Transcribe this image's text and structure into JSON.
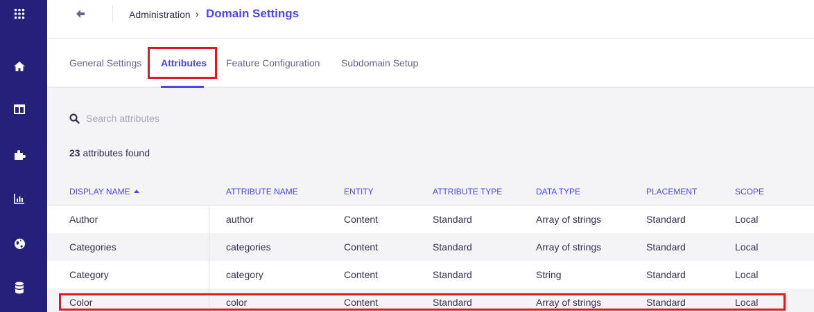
{
  "sidebar": {
    "items": [
      {
        "icon": "grid-menu-icon"
      },
      {
        "icon": "home-icon"
      },
      {
        "icon": "layout-icon"
      },
      {
        "icon": "puzzle-icon"
      },
      {
        "icon": "chart-icon"
      },
      {
        "icon": "globe-icon"
      },
      {
        "icon": "database-icon"
      }
    ]
  },
  "header": {
    "breadcrumb_parent": "Administration",
    "breadcrumb_separator": "›",
    "title": "Domain Settings"
  },
  "tabs": [
    {
      "label": "General Settings",
      "active": false
    },
    {
      "label": "Attributes",
      "active": true
    },
    {
      "label": "Feature Configuration",
      "active": false
    },
    {
      "label": "Subdomain Setup",
      "active": false
    }
  ],
  "search": {
    "placeholder": "Search attributes",
    "value": ""
  },
  "results": {
    "count": "23",
    "suffix": " attributes found"
  },
  "table": {
    "columns": [
      "DISPLAY NAME",
      "ATTRIBUTE NAME",
      "ENTITY",
      "ATTRIBUTE TYPE",
      "DATA TYPE",
      "PLACEMENT",
      "SCOPE"
    ],
    "sort_column": "DISPLAY NAME",
    "sort_direction": "asc",
    "rows": [
      [
        "Author",
        "author",
        "Content",
        "Standard",
        "Array of strings",
        "Standard",
        "Local"
      ],
      [
        "Categories",
        "categories",
        "Content",
        "Standard",
        "Array of strings",
        "Standard",
        "Local"
      ],
      [
        "Category",
        "category",
        "Content",
        "Standard",
        "String",
        "Standard",
        "Local"
      ],
      [
        "Color",
        "color",
        "Content",
        "Standard",
        "Array of strings",
        "Standard",
        "Local"
      ]
    ]
  },
  "colors": {
    "sidebar_bg": "#23217a",
    "accent": "#4945ff",
    "highlight": "#e0181f"
  }
}
